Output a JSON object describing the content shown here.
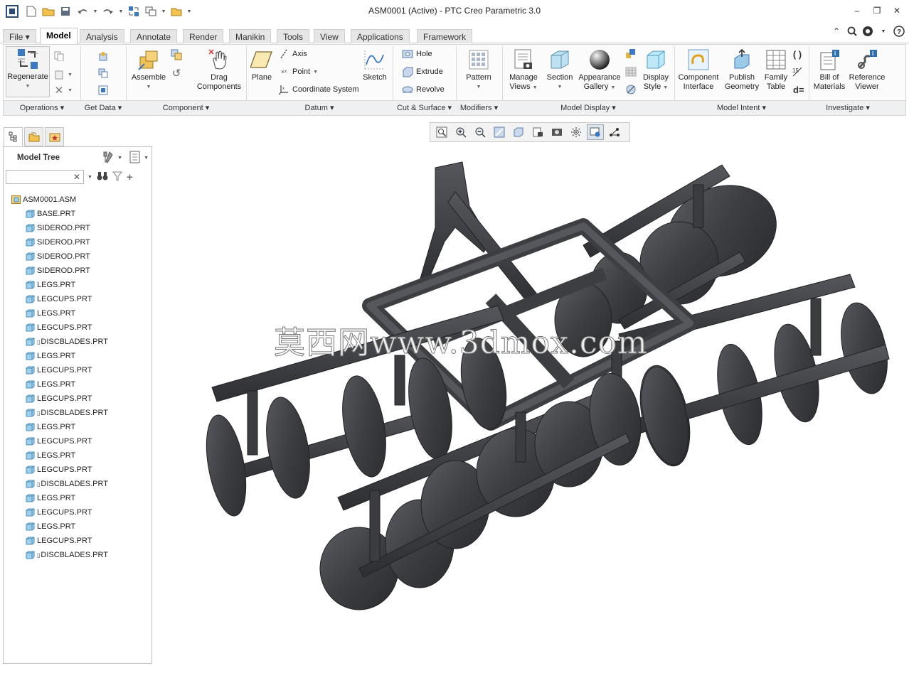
{
  "window": {
    "title": "ASM0001 (Active) - PTC Creo Parametric 3.0"
  },
  "tabs": [
    {
      "label": "File ▾"
    },
    {
      "label": "Model"
    },
    {
      "label": "Analysis"
    },
    {
      "label": "Annotate"
    },
    {
      "label": "Render"
    },
    {
      "label": "Manikin"
    },
    {
      "label": "Tools"
    },
    {
      "label": "View"
    },
    {
      "label": "Applications"
    },
    {
      "label": "Framework"
    }
  ],
  "ribbon": {
    "operations": {
      "regenerate": "Regenerate"
    },
    "component": {
      "assemble": "Assemble",
      "drag_line1": "Drag",
      "drag_line2": "Components"
    },
    "datum": {
      "plane": "Plane",
      "axis": "Axis",
      "point": "Point",
      "coordinate_system": "Coordinate System",
      "sketch": "Sketch"
    },
    "cut_surface": {
      "hole": "Hole",
      "extrude": "Extrude",
      "revolve": "Revolve"
    },
    "modifiers": {
      "pattern": "Pattern"
    },
    "model_display": {
      "manage_views_1": "Manage",
      "manage_views_2": "Views",
      "section": "Section",
      "appearance_1": "Appearance",
      "appearance_2": "Gallery",
      "display_style_1": "Display",
      "display_style_2": "Style"
    },
    "model_intent": {
      "component_interface_1": "Component",
      "component_interface_2": "Interface",
      "publish_geometry_1": "Publish",
      "publish_geometry_2": "Geometry",
      "family_table_1": "Family",
      "family_table_2": "Table",
      "d_equals": "d="
    },
    "investigate": {
      "bill_of_materials_1": "Bill of",
      "bill_of_materials_2": "Materials",
      "reference_viewer_1": "Reference",
      "reference_viewer_2": "Viewer"
    },
    "groups": {
      "operations": "Operations ▾",
      "get_data": "Get Data ▾",
      "component": "Component ▾",
      "datum": "Datum ▾",
      "cut_surface": "Cut & Surface ▾",
      "modifiers": "Modifiers ▾",
      "model_display": "Model Display ▾",
      "model_intent": "Model Intent ▾",
      "investigate": "Investigate ▾"
    }
  },
  "model_tree": {
    "title": "Model Tree",
    "search_placeholder": "",
    "root": "ASM0001.ASM",
    "items": [
      {
        "name": "BASE.PRT",
        "flag": ""
      },
      {
        "name": "SIDEROD.PRT",
        "flag": ""
      },
      {
        "name": "SIDEROD.PRT",
        "flag": ""
      },
      {
        "name": "SIDEROD.PRT",
        "flag": ""
      },
      {
        "name": "SIDEROD.PRT",
        "flag": ""
      },
      {
        "name": "LEGS.PRT",
        "flag": ""
      },
      {
        "name": "LEGCUPS.PRT",
        "flag": ""
      },
      {
        "name": "LEGS.PRT",
        "flag": ""
      },
      {
        "name": "LEGCUPS.PRT",
        "flag": ""
      },
      {
        "name": "DISCBLADES.PRT",
        "flag": "▯"
      },
      {
        "name": "LEGS.PRT",
        "flag": ""
      },
      {
        "name": "LEGCUPS.PRT",
        "flag": ""
      },
      {
        "name": "LEGS.PRT",
        "flag": ""
      },
      {
        "name": "LEGCUPS.PRT",
        "flag": ""
      },
      {
        "name": "DISCBLADES.PRT",
        "flag": "▯"
      },
      {
        "name": "LEGS.PRT",
        "flag": ""
      },
      {
        "name": "LEGCUPS.PRT",
        "flag": ""
      },
      {
        "name": "LEGS.PRT",
        "flag": ""
      },
      {
        "name": "LEGCUPS.PRT",
        "flag": ""
      },
      {
        "name": "DISCBLADES.PRT",
        "flag": "▯"
      },
      {
        "name": "LEGS.PRT",
        "flag": ""
      },
      {
        "name": "LEGCUPS.PRT",
        "flag": ""
      },
      {
        "name": "LEGS.PRT",
        "flag": ""
      },
      {
        "name": "LEGCUPS.PRT",
        "flag": ""
      },
      {
        "name": "DISCBLADES.PRT",
        "flag": "▯"
      }
    ]
  },
  "viewport": {
    "watermark": "莫西网www.3dmox.com"
  },
  "colors": {
    "accent": "#2e75b6",
    "model": "#3a3c40",
    "ribbon_bg": "#fbfbfb",
    "group_bar": "#eef0f2"
  },
  "icons": [
    "app-logo-icon",
    "new-icon",
    "open-icon",
    "save-icon",
    "undo-icon",
    "redo-icon",
    "regenerate-icon",
    "window-icon",
    "close-window-icon",
    "search-icon",
    "help-icon"
  ]
}
